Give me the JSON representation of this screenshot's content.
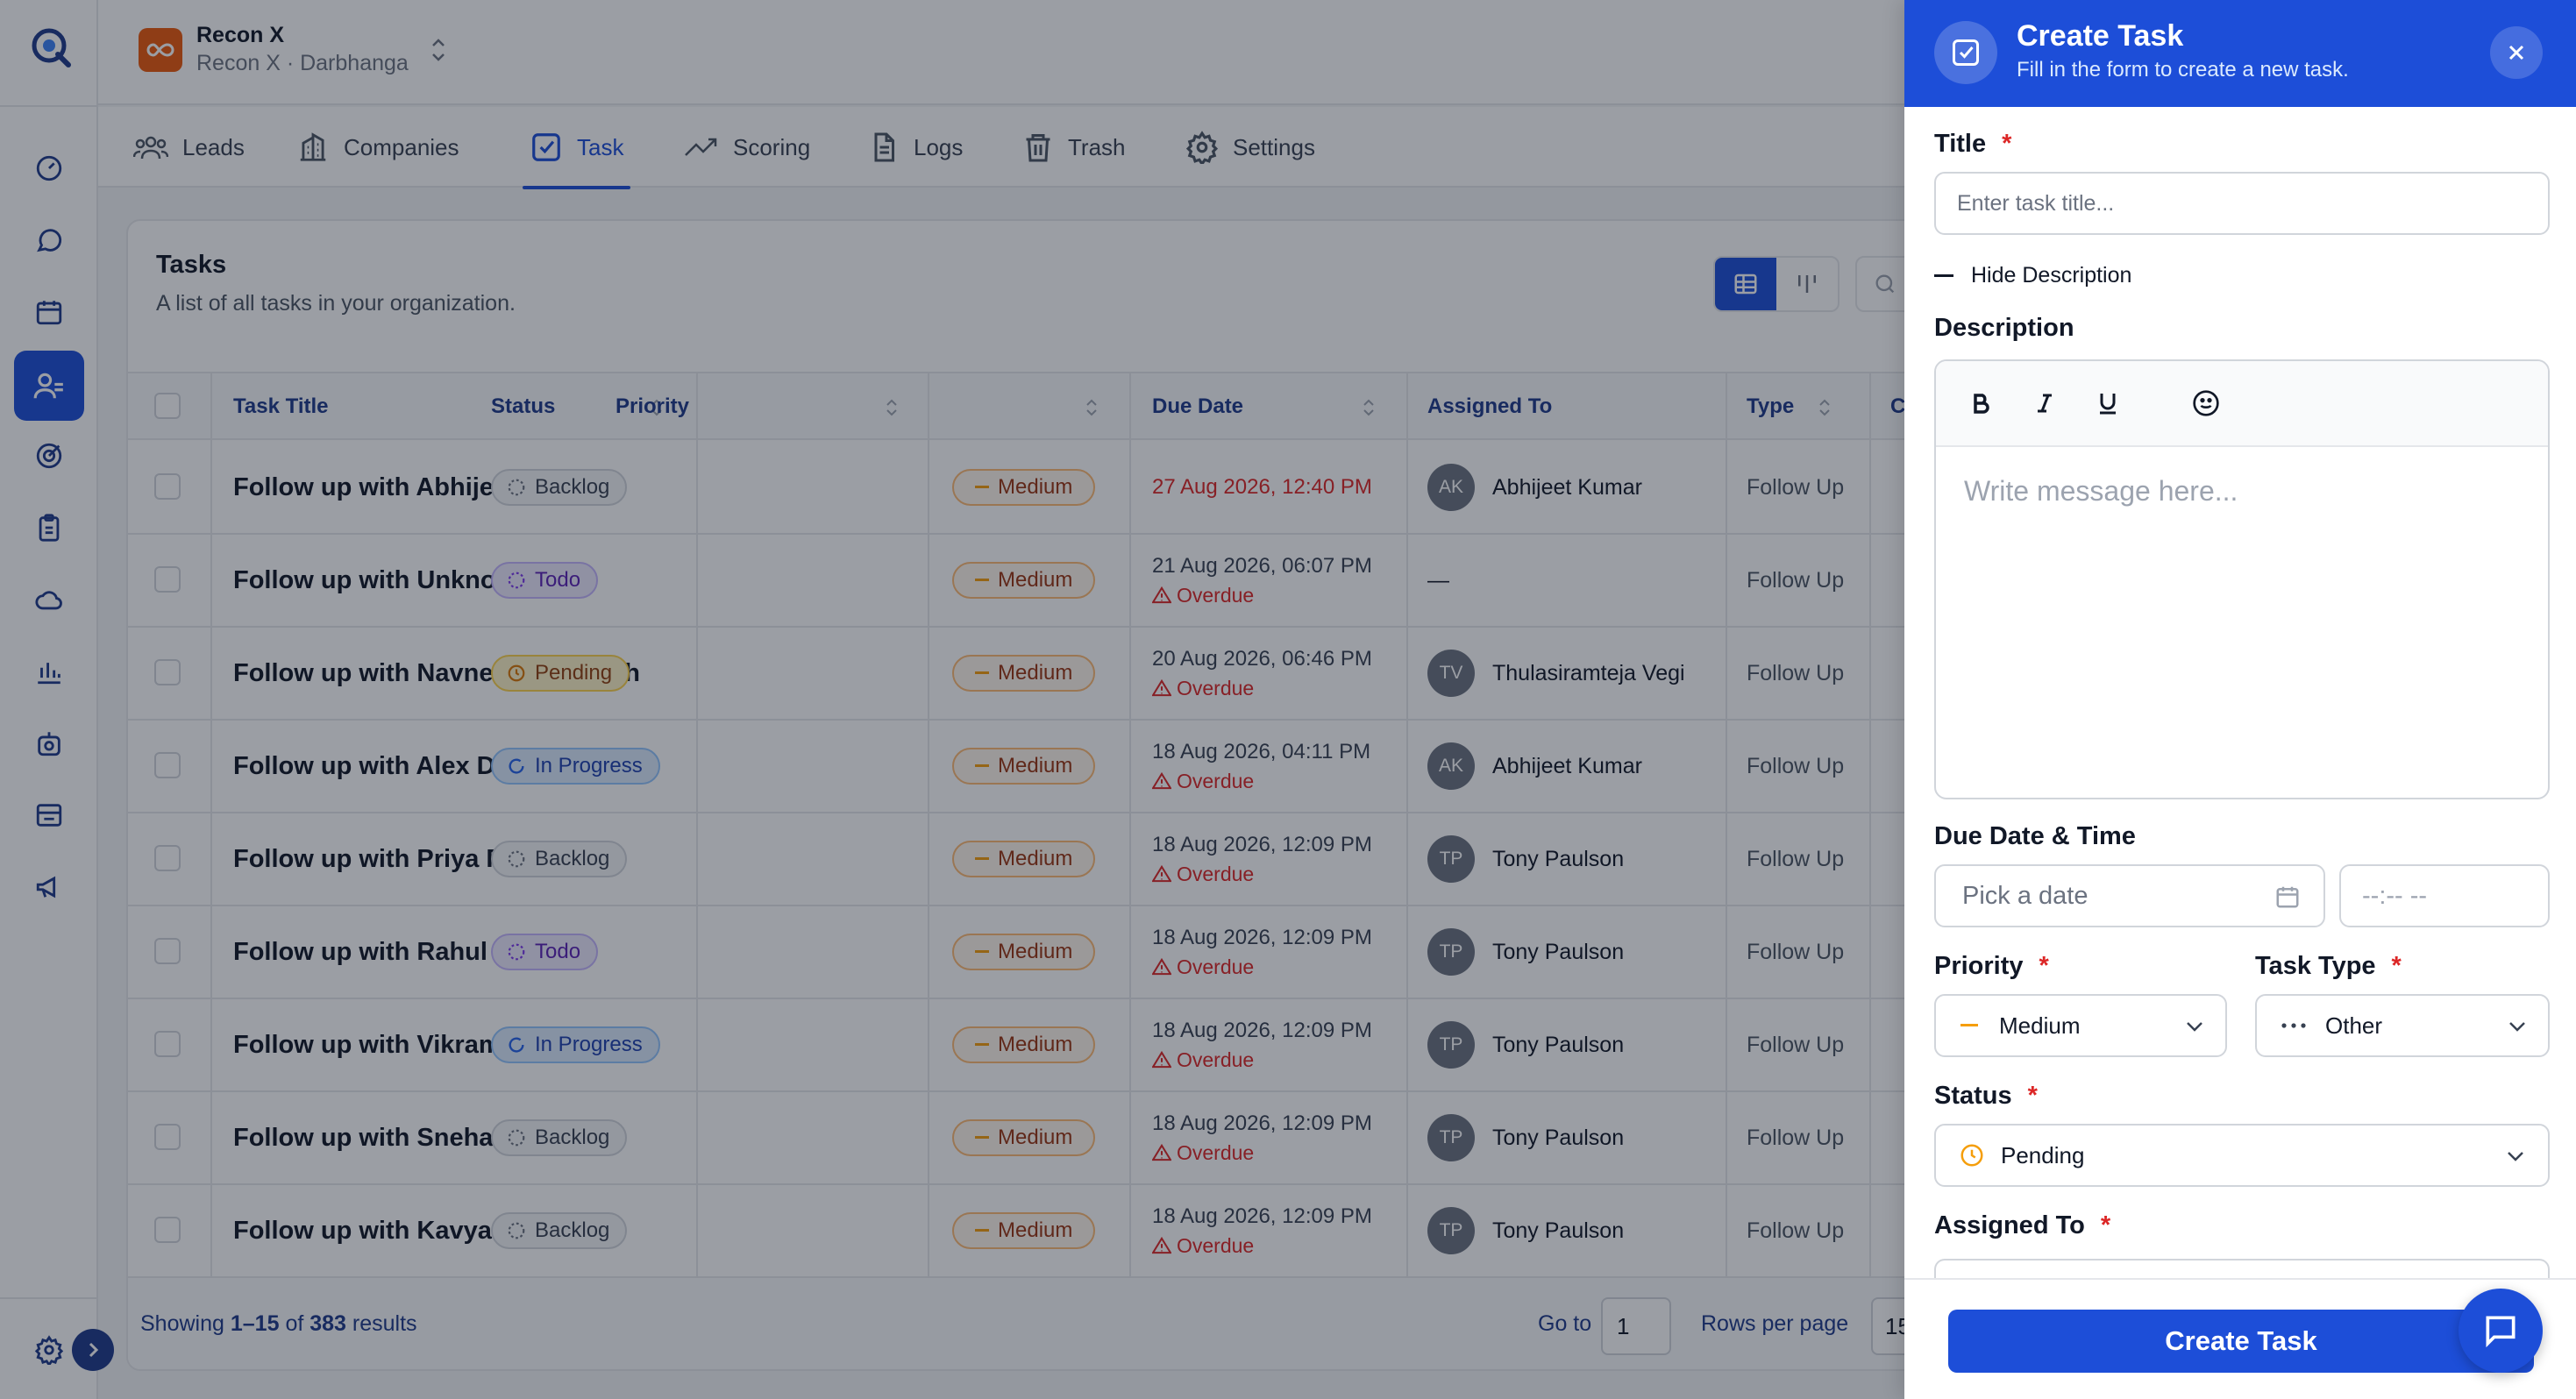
{
  "workspace": {
    "name": "Recon X",
    "subtitle": "Recon X · Darbhanga"
  },
  "tabs": [
    {
      "label": "Leads"
    },
    {
      "label": "Companies"
    },
    {
      "label": "Task",
      "active": true
    },
    {
      "label": "Scoring"
    },
    {
      "label": "Logs"
    },
    {
      "label": "Trash"
    },
    {
      "label": "Settings"
    }
  ],
  "tasks_card": {
    "title": "Tasks",
    "subtitle": "A list of all tasks in your organization."
  },
  "table": {
    "columns": [
      "Task Title",
      "Status",
      "Priority",
      "Due Date",
      "Assigned To",
      "Type",
      "C"
    ],
    "rows": [
      {
        "title": "Follow up with Abhijeet Kumar",
        "status": "Backlog",
        "priority": "Medium",
        "due": "27 Aug 2026, 12:40 PM",
        "overdue": "",
        "initials": "AK",
        "assignee": "Abhijeet Kumar",
        "type": "Follow Up"
      },
      {
        "title": "Follow up with Unknown",
        "status": "Todo",
        "priority": "Medium",
        "due": "21 Aug 2026, 06:07 PM",
        "overdue": "Overdue",
        "initials": "",
        "assignee": "—",
        "type": "Follow Up"
      },
      {
        "title": "Follow up with Navneet Raj Singh",
        "status": "Pending",
        "priority": "Medium",
        "due": "20 Aug 2026, 06:46 PM",
        "overdue": "Overdue",
        "initials": "TV",
        "assignee": "Thulasiramteja Vegi",
        "type": "Follow Up"
      },
      {
        "title": "Follow up with Alex Demo",
        "status": "In Progress",
        "priority": "Medium",
        "due": "18 Aug 2026, 04:11 PM",
        "overdue": "Overdue",
        "initials": "AK",
        "assignee": "Abhijeet Kumar",
        "type": "Follow Up"
      },
      {
        "title": "Follow up with Priya Patel",
        "status": "Backlog",
        "priority": "Medium",
        "due": "18 Aug 2026, 12:09 PM",
        "overdue": "Overdue",
        "initials": "TP",
        "assignee": "Tony Paulson",
        "type": "Follow Up"
      },
      {
        "title": "Follow up with Rahul Sharma",
        "status": "Todo",
        "priority": "Medium",
        "due": "18 Aug 2026, 12:09 PM",
        "overdue": "Overdue",
        "initials": "TP",
        "assignee": "Tony Paulson",
        "type": "Follow Up"
      },
      {
        "title": "Follow up with Vikram Singh",
        "status": "In Progress",
        "priority": "Medium",
        "due": "18 Aug 2026, 12:09 PM",
        "overdue": "Overdue",
        "initials": "TP",
        "assignee": "Tony Paulson",
        "type": "Follow Up"
      },
      {
        "title": "Follow up with Sneha Reddy",
        "status": "Backlog",
        "priority": "Medium",
        "due": "18 Aug 2026, 12:09 PM",
        "overdue": "Overdue",
        "initials": "TP",
        "assignee": "Tony Paulson",
        "type": "Follow Up"
      },
      {
        "title": "Follow up with Kavya Nair",
        "status": "Backlog",
        "priority": "Medium",
        "due": "18 Aug 2026, 12:09 PM",
        "overdue": "Overdue",
        "initials": "TP",
        "assignee": "Tony Paulson",
        "type": "Follow Up"
      }
    ]
  },
  "pagination": {
    "prefix": "Showing",
    "range": "1–15",
    "of": "of",
    "total": "383",
    "suffix": "results",
    "goto_label": "Go to",
    "goto_value": "1",
    "rows_label": "Rows per page",
    "rows_value": "15"
  },
  "panel": {
    "title": "Create Task",
    "subtitle": "Fill in the form to create a new task.",
    "title_label": "Title",
    "title_placeholder": "Enter task title...",
    "hide_description": "Hide Description",
    "description_label": "Description",
    "editor_placeholder": "Write message here...",
    "due_label": "Due Date & Time",
    "date_placeholder": "Pick a date",
    "time_placeholder": "--:-- --",
    "priority_label": "Priority",
    "priority_value": "Medium",
    "task_type_label": "Task Type",
    "task_type_value": "Other",
    "status_label": "Status",
    "status_value": "Pending",
    "assigned_label": "Assigned To",
    "required_mark": "*",
    "submit_label": "Create Task"
  },
  "icons": {
    "rail": [
      "dashboard-icon",
      "chat-icon",
      "calendar-icon",
      "users-icon",
      "target-icon",
      "clipboard-icon",
      "cloud-icon",
      "bar-chart-icon",
      "robot-icon",
      "inbox-icon",
      "megaphone-icon"
    ],
    "bottom": [
      "settings-icon",
      "chevron-right-icon"
    ]
  },
  "colors": {
    "primary": "#1d4ed8",
    "danger": "#dc2626",
    "warning": "#f59e0b"
  }
}
